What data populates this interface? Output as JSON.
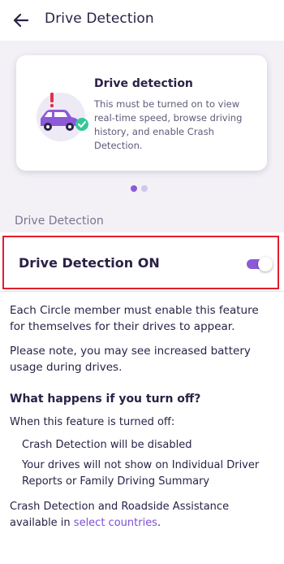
{
  "header": {
    "title": "Drive Detection",
    "back_icon": "arrow-left-icon"
  },
  "card": {
    "title": "Drive detection",
    "description": "This must be turned on to view real-time speed, browse driving history, and enable Crash Detection.",
    "illustration": "car-warning-check-illustration"
  },
  "pagination": {
    "current_page": 1,
    "total_pages": 2
  },
  "section": {
    "label": "Drive Detection"
  },
  "toggle": {
    "label": "Drive Detection ON",
    "value": true
  },
  "info": {
    "paragraph1": "Each Circle member must enable this feature for themselves for their drives to appear.",
    "paragraph2": "Please note, you may see increased battery usage during drives.",
    "question": "What happens if you turn off?",
    "when_off": "When this feature is turned off:",
    "consequence1": "Crash Detection will be disabled",
    "consequence2": "Your drives will not show on Individual Driver Reports or Family Driving Summary",
    "availability_prefix": "Crash Detection and Roadside Assistance available in ",
    "availability_link": "select countries",
    "availability_suffix": "."
  },
  "colors": {
    "accent": "#8c5ad8",
    "highlight_border": "#e21e2d",
    "text": "#2b2146",
    "panel_bg": "#f3f1f6"
  }
}
